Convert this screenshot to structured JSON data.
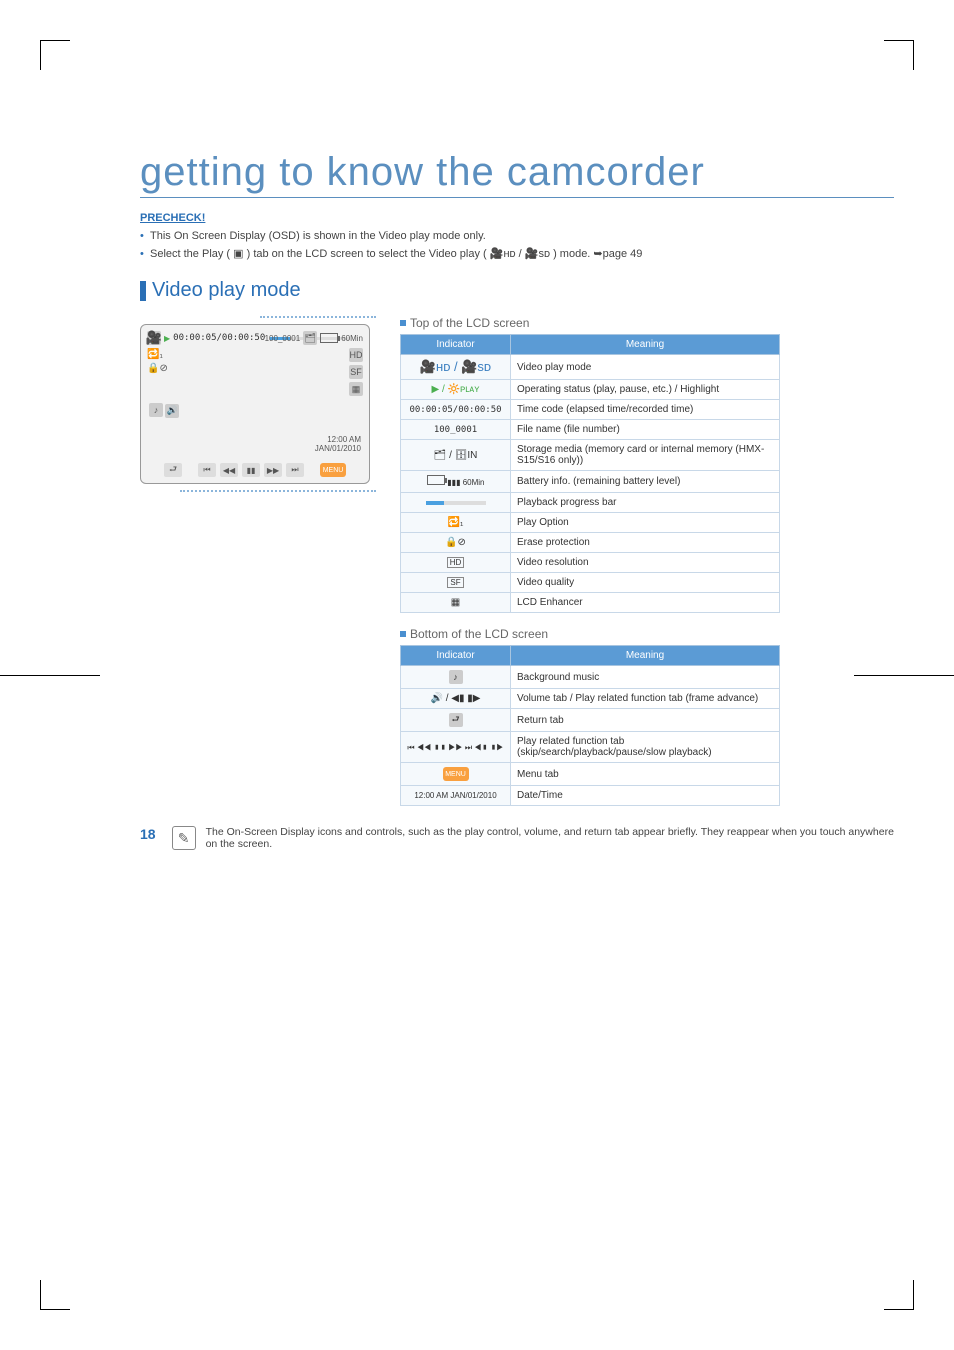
{
  "page_number": "18",
  "main_title": "getting to know the camcorder",
  "precheck_label": "PRECHECK!",
  "precheck_bullets": [
    "This On Screen Display (OSD) is shown in the Video play mode only.",
    "Select the Play ( ▣ ) tab on the LCD screen to select the Video play ( 🎥ʜᴅ / 🎥sᴅ ) mode. ➥page 49"
  ],
  "section_title": "Video play mode",
  "top_caption": "Top of the LCD screen",
  "bottom_caption": "Bottom of the LCD screen",
  "th_indicator": "Indicator",
  "th_meaning": "Meaning",
  "top_rows": [
    {
      "icon": "🎥ʜᴅ / 🎥sᴅ",
      "meaning": "Video play mode"
    },
    {
      "icon": "▶ / 🔆ᴘʟᴀʏ",
      "meaning": "Operating status (play, pause, etc.) / Highlight"
    },
    {
      "icon": "00:00:05/00:00:50",
      "meaning": "Time code (elapsed time/recorded time)"
    },
    {
      "icon": "100_0001",
      "meaning": "File name (file number)"
    },
    {
      "icon": "🗂 / 🗄IN",
      "meaning": "Storage media (memory card or internal memory (HMX-S15/S16 only))"
    },
    {
      "icon": "▮▮▮ 60Min",
      "meaning": "Battery info. (remaining battery level)"
    },
    {
      "icon": "progress",
      "meaning": "Playback progress bar"
    },
    {
      "icon": "🔁₁",
      "meaning": "Play Option"
    },
    {
      "icon": "🔒⊘",
      "meaning": "Erase protection"
    },
    {
      "icon": "HD",
      "meaning": "Video resolution"
    },
    {
      "icon": "SF",
      "meaning": "Video quality"
    },
    {
      "icon": "▦",
      "meaning": "LCD Enhancer"
    }
  ],
  "bottom_rows": [
    {
      "icon": "♪",
      "meaning": "Background music"
    },
    {
      "icon": "🔊 / ◀▮ ▮▶",
      "meaning": "Volume tab / Play related function tab (frame advance)"
    },
    {
      "icon": "⮐",
      "meaning": "Return tab"
    },
    {
      "icon": "⏮ ◀◀ ▮▮ ▶▶ ⏭  ◀▮ ▮▶",
      "meaning": "Play related function tab (skip/search/playback/pause/slow playback)"
    },
    {
      "icon": "MENU",
      "meaning": "Menu tab"
    },
    {
      "icon": "12:00 AM  JAN/01/2010",
      "meaning": "Date/Time"
    }
  ],
  "lcd": {
    "play": "▶",
    "tc": "00:00:05/00:00:50",
    "file": "100_0001",
    "batt": "60Min",
    "opt": "🔁₁",
    "lock": "🔒⊘",
    "hd": "HD",
    "sf": "SF",
    "enh": "▦",
    "music": "♪",
    "vol": "🔊",
    "ret": "⮐",
    "time_a": "12:00 AM",
    "time_b": "JAN/01/2010",
    "c1": "⏮",
    "c2": "◀◀",
    "c3": "▮▮",
    "c4": "▶▶",
    "c5": "⏭",
    "menu": "MENU"
  },
  "note_text": "The On-Screen Display icons and controls, such as the play control, volume, and return tab appear briefly. They reappear when you touch anywhere on the screen."
}
